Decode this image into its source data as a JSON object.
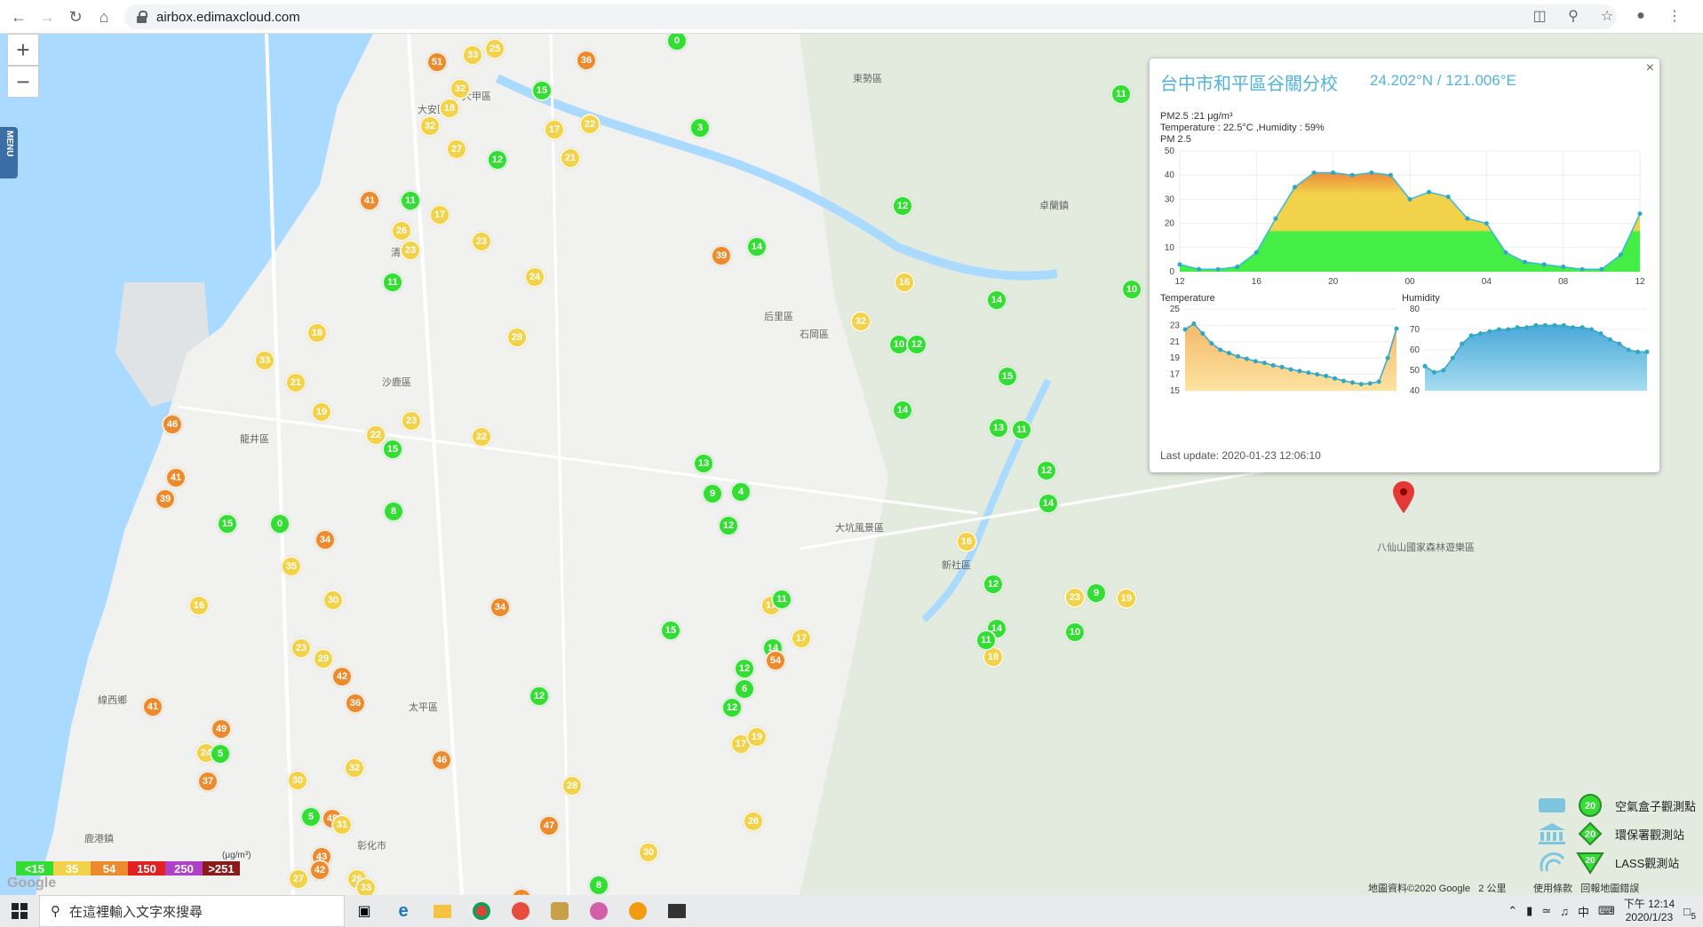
{
  "browser": {
    "url": "airbox.edimaxcloud.com"
  },
  "map": {
    "zoom_in": "+",
    "zoom_out": "−",
    "menu_label": "MENU",
    "places": [
      "大安區",
      "大甲區",
      "沙鹿區",
      "龍井區",
      "清水區",
      "鹿港鎮",
      "線西鄉",
      "彰化市",
      "大坑風景區",
      "卓蘭鎮",
      "新社區",
      "太平區",
      "八仙山國家森林遊樂區",
      "后里區",
      "東勢區",
      "石岡區"
    ],
    "markers": [
      {
        "v": "51",
        "c": "o"
      },
      {
        "v": "33",
        "c": "y"
      },
      {
        "v": "25",
        "c": "y"
      },
      {
        "v": "36",
        "c": "o"
      },
      {
        "v": "0",
        "c": "g"
      },
      {
        "v": "32",
        "c": "y"
      },
      {
        "v": "18",
        "c": "y"
      },
      {
        "v": "15",
        "c": "g"
      },
      {
        "v": "17",
        "c": "y"
      },
      {
        "v": "22",
        "c": "y"
      },
      {
        "v": "3",
        "c": "g"
      },
      {
        "v": "11",
        "c": "g"
      },
      {
        "v": "12",
        "c": "g"
      },
      {
        "v": "32",
        "c": "y"
      },
      {
        "v": "27",
        "c": "y"
      },
      {
        "v": "21",
        "c": "y"
      },
      {
        "v": "41",
        "c": "o"
      },
      {
        "v": "11",
        "c": "g"
      },
      {
        "v": "17",
        "c": "y"
      },
      {
        "v": "23",
        "c": "y"
      },
      {
        "v": "26",
        "c": "y"
      },
      {
        "v": "11",
        "c": "g"
      },
      {
        "v": "23",
        "c": "y"
      },
      {
        "v": "24",
        "c": "y"
      },
      {
        "v": "28",
        "c": "y"
      },
      {
        "v": "22",
        "c": "y"
      },
      {
        "v": "39",
        "c": "o"
      },
      {
        "v": "14",
        "c": "g"
      },
      {
        "v": "12",
        "c": "g"
      },
      {
        "v": "10",
        "c": "g"
      },
      {
        "v": "16",
        "c": "y"
      },
      {
        "v": "32",
        "c": "y"
      },
      {
        "v": "12",
        "c": "g"
      },
      {
        "v": "14",
        "c": "g"
      },
      {
        "v": "10",
        "c": "g"
      },
      {
        "v": "46",
        "c": "o"
      },
      {
        "v": "41",
        "c": "o"
      },
      {
        "v": "39",
        "c": "o"
      },
      {
        "v": "33",
        "c": "y"
      },
      {
        "v": "21",
        "c": "y"
      },
      {
        "v": "18",
        "c": "y"
      },
      {
        "v": "19",
        "c": "y"
      },
      {
        "v": "22",
        "c": "y"
      },
      {
        "v": "23",
        "c": "y"
      },
      {
        "v": "15",
        "c": "g"
      },
      {
        "v": "8",
        "c": "g"
      },
      {
        "v": "0",
        "c": "g"
      },
      {
        "v": "15",
        "c": "g"
      },
      {
        "v": "35",
        "c": "y"
      },
      {
        "v": "16",
        "c": "y"
      },
      {
        "v": "34",
        "c": "o"
      },
      {
        "v": "30",
        "c": "y"
      },
      {
        "v": "23",
        "c": "y"
      },
      {
        "v": "29",
        "c": "y"
      },
      {
        "v": "42",
        "c": "o"
      },
      {
        "v": "36",
        "c": "o"
      },
      {
        "v": "41",
        "c": "o"
      },
      {
        "v": "49",
        "c": "o"
      },
      {
        "v": "24",
        "c": "y"
      },
      {
        "v": "37",
        "c": "o"
      },
      {
        "v": "5",
        "c": "g"
      },
      {
        "v": "30",
        "c": "y"
      },
      {
        "v": "32",
        "c": "y"
      },
      {
        "v": "46",
        "c": "o"
      },
      {
        "v": "45",
        "c": "o"
      },
      {
        "v": "31",
        "c": "y"
      },
      {
        "v": "5",
        "c": "g"
      },
      {
        "v": "43",
        "c": "o"
      },
      {
        "v": "42",
        "c": "o"
      },
      {
        "v": "27",
        "c": "y"
      },
      {
        "v": "26",
        "c": "y"
      },
      {
        "v": "33",
        "c": "y"
      },
      {
        "v": "34",
        "c": "o"
      },
      {
        "v": "12",
        "c": "g"
      },
      {
        "v": "13",
        "c": "g"
      },
      {
        "v": "9",
        "c": "g"
      },
      {
        "v": "4",
        "c": "g"
      },
      {
        "v": "12",
        "c": "g"
      },
      {
        "v": "17",
        "c": "y"
      },
      {
        "v": "11",
        "c": "g"
      },
      {
        "v": "14",
        "c": "g"
      },
      {
        "v": "12",
        "c": "g"
      },
      {
        "v": "17",
        "c": "y"
      },
      {
        "v": "15",
        "c": "g"
      },
      {
        "v": "6",
        "c": "g"
      },
      {
        "v": "54",
        "c": "o"
      },
      {
        "v": "12",
        "c": "g"
      },
      {
        "v": "17",
        "c": "y"
      },
      {
        "v": "19",
        "c": "y"
      },
      {
        "v": "26",
        "c": "y"
      },
      {
        "v": "47",
        "c": "o"
      },
      {
        "v": "28",
        "c": "y"
      },
      {
        "v": "30",
        "c": "y"
      },
      {
        "v": "8",
        "c": "g"
      },
      {
        "v": "43",
        "c": "o"
      },
      {
        "v": "9",
        "c": "g"
      },
      {
        "v": "19",
        "c": "y"
      },
      {
        "v": "10",
        "c": "g"
      },
      {
        "v": "14",
        "c": "g"
      },
      {
        "v": "12",
        "c": "g"
      },
      {
        "v": "23",
        "c": "y"
      },
      {
        "v": "14",
        "c": "g"
      },
      {
        "v": "11",
        "c": "g"
      },
      {
        "v": "13",
        "c": "g"
      },
      {
        "v": "15",
        "c": "g"
      },
      {
        "v": "12",
        "c": "g"
      },
      {
        "v": "14",
        "c": "g"
      },
      {
        "v": "16",
        "c": "y"
      },
      {
        "v": "18",
        "c": "y"
      },
      {
        "v": "11",
        "c": "g"
      }
    ]
  },
  "popup": {
    "close": "×",
    "title": "台中市和平區谷關分校",
    "coords": "24.202°N / 121.006°E",
    "pm25_line": "PM2.5 :21 μg/m³",
    "temp_line": "Temperature : 22.5°C ,Humidity : 59%",
    "pm_label": "PM 2.5",
    "temperature_label": "Temperature",
    "humidity_label": "Humidity",
    "last_update": "Last update: 2020-01-23 12:06:10",
    "pm_y_ticks": [
      "50",
      "40",
      "30",
      "20",
      "10",
      "0"
    ],
    "x_ticks": [
      "12",
      "16",
      "20",
      "00",
      "04",
      "08",
      "12"
    ],
    "temp_y_ticks": [
      "25",
      "23",
      "21",
      "19",
      "17",
      "15"
    ],
    "hum_y_ticks": [
      "80",
      "70",
      "60",
      "50",
      "40"
    ]
  },
  "chart_data": [
    {
      "type": "area",
      "title": "PM 2.5",
      "x": [
        "12",
        "13",
        "14",
        "15",
        "16",
        "17",
        "18",
        "19",
        "20",
        "21",
        "22",
        "23",
        "00",
        "01",
        "02",
        "03",
        "04",
        "05",
        "06",
        "07",
        "08",
        "09",
        "10",
        "11",
        "12"
      ],
      "values": [
        3,
        1,
        1,
        2,
        8,
        22,
        35,
        41,
        41,
        40,
        41,
        40,
        30,
        33,
        31,
        22,
        20,
        8,
        4,
        3,
        2,
        1,
        1,
        7,
        24
      ],
      "ylim": [
        0,
        50
      ]
    },
    {
      "type": "area",
      "title": "Temperature",
      "x": [
        "12",
        "13",
        "14",
        "15",
        "16",
        "17",
        "18",
        "19",
        "20",
        "21",
        "22",
        "23",
        "00",
        "01",
        "02",
        "03",
        "04",
        "05",
        "06",
        "07",
        "08",
        "09",
        "10",
        "11",
        "12"
      ],
      "values": [
        22.5,
        23.2,
        22.0,
        20.8,
        20.0,
        19.6,
        19.2,
        18.9,
        18.6,
        18.4,
        18.1,
        17.9,
        17.6,
        17.4,
        17.2,
        17.0,
        16.8,
        16.5,
        16.2,
        16.0,
        15.8,
        15.9,
        16.1,
        19.0,
        22.6
      ],
      "ylim": [
        15,
        25
      ]
    },
    {
      "type": "area",
      "title": "Humidity",
      "x": [
        "12",
        "13",
        "14",
        "15",
        "16",
        "17",
        "18",
        "19",
        "20",
        "21",
        "22",
        "23",
        "00",
        "01",
        "02",
        "03",
        "04",
        "05",
        "06",
        "07",
        "08",
        "09",
        "10",
        "11",
        "12"
      ],
      "values": [
        52,
        49,
        50,
        56,
        63,
        67,
        68,
        69,
        70,
        70,
        71,
        71,
        72,
        72,
        72,
        72,
        71,
        71,
        70,
        68,
        65,
        63,
        60,
        59,
        59
      ],
      "ylim": [
        40,
        80
      ]
    }
  ],
  "legend": {
    "aqi": [
      {
        "label": "<15",
        "color": "#33dd33"
      },
      {
        "label": "35",
        "color": "#f2d24a"
      },
      {
        "label": "54",
        "color": "#ec8a2e"
      },
      {
        "label": "150",
        "color": "#e22222"
      },
      {
        "label": "250",
        "color": "#b040c8"
      },
      {
        "label": ">251",
        "color": "#8b1a1a"
      }
    ],
    "unit": "(μg/m³)",
    "types": [
      {
        "label": "空氣盒子觀測點",
        "value": "20"
      },
      {
        "label": "環保署觀測站",
        "value": "20"
      },
      {
        "label": "LASS觀測站",
        "value": "20"
      }
    ]
  },
  "attribution": {
    "data": "地圖資料©2020 Google",
    "scale": "2 公里",
    "terms": "使用條款",
    "report": "回報地圖錯誤",
    "logo": "Google"
  },
  "taskbar": {
    "search_placeholder": "在這裡輸入文字來搜尋",
    "time": "下午 12:14",
    "date": "2020/1/23",
    "ime": "中",
    "notif_count": "5"
  }
}
